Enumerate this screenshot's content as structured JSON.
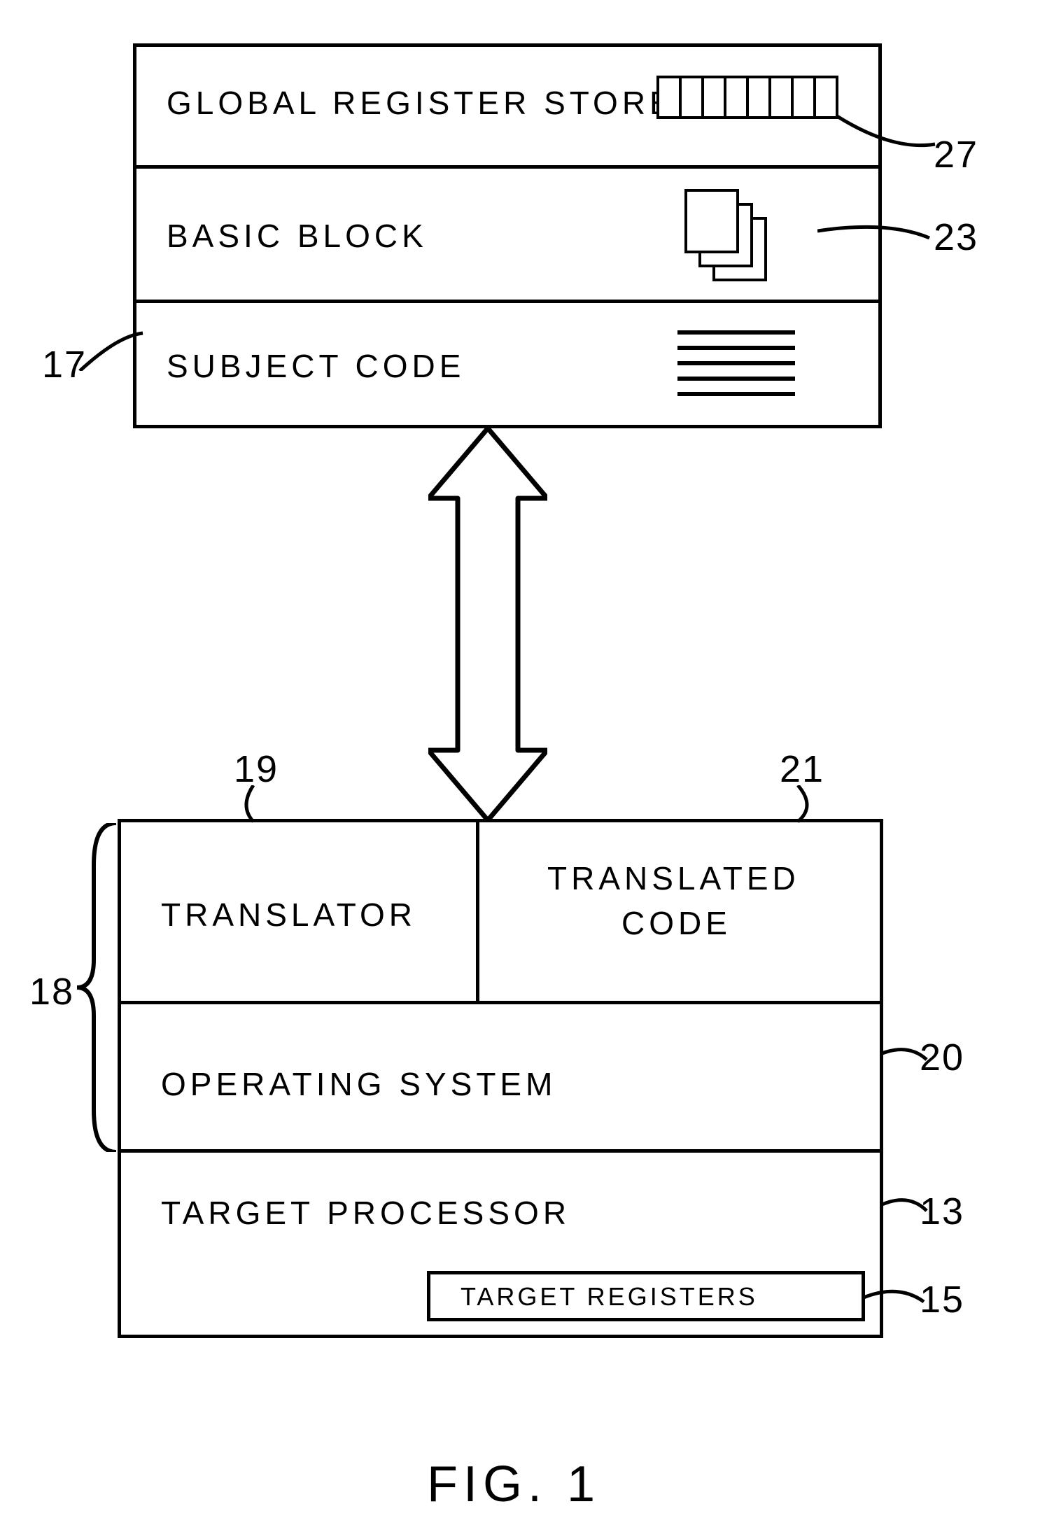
{
  "top_block": {
    "global_register_store": "GLOBAL REGISTER STORE",
    "basic_block": "BASIC BLOCK",
    "subject_code": "SUBJECT CODE"
  },
  "bottom_block": {
    "translator": "TRANSLATOR",
    "translated_code_line1": "TRANSLATED",
    "translated_code_line2": "CODE",
    "operating_system": "OPERATING  SYSTEM",
    "target_processor": "TARGET PROCESSOR",
    "target_registers": "TARGET  REGISTERS"
  },
  "refs": {
    "n27": "27",
    "n23": "23",
    "n17": "17",
    "n19": "19",
    "n21": "21",
    "n18": "18",
    "n20": "20",
    "n13": "13",
    "n15": "15"
  },
  "figure_caption": "FIG. 1"
}
